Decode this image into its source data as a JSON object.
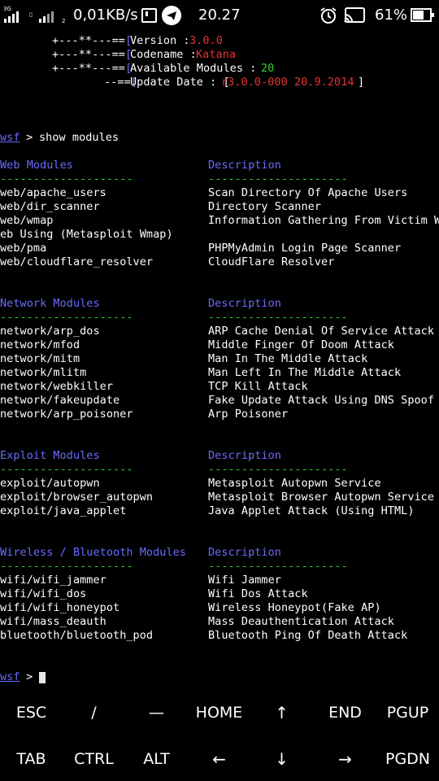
{
  "status_bar": {
    "network_type": "3G",
    "sim_slot": "2",
    "net_speed": "0,01KB/s",
    "time": "20.27",
    "battery": "61%",
    "icons": [
      "signal-icon",
      "signal-icon",
      "sim-icon",
      "telegram-icon",
      "alarm-icon",
      "cast-icon",
      "battery-icon"
    ]
  },
  "banner": [
    {
      "prefix": "+---**---==[",
      "label": "Version :",
      "value": "3.0.0"
    },
    {
      "prefix": "+---**---==[",
      "label": "Codename :",
      "value": "Katana"
    },
    {
      "prefix": "+---**---==[",
      "label": "Available Modules : ",
      "value": "20"
    },
    {
      "prefix": "--==[",
      "label": "Update Date : [",
      "value": "r3.0.0-000 20.9.2014",
      "suffix": "]"
    }
  ],
  "prompt1": {
    "name": "wsf",
    "sep": " > ",
    "command": "show modules"
  },
  "sections": [
    {
      "title": "Web Modules",
      "desc_title": "Description",
      "dash_left": "--------------------",
      "dash_right": "---------------------",
      "rows": [
        {
          "name": "web/apache_users",
          "desc": "Scan Directory Of Apache Users"
        },
        {
          "name": "web/dir_scanner",
          "desc": "Directory Scanner"
        },
        {
          "name": "web/wmap",
          "desc": "Information Gathering From Victim W"
        },
        {
          "name": "eb Using (Metasploit Wmap)",
          "desc": ""
        },
        {
          "name": "web/pma",
          "desc": "PHPMyAdmin Login Page Scanner"
        },
        {
          "name": "web/cloudflare_resolver",
          "desc": "CloudFlare Resolver"
        }
      ]
    },
    {
      "title": "Network Modules",
      "desc_title": "Description",
      "dash_left": "--------------------",
      "dash_right": "---------------------",
      "rows": [
        {
          "name": "network/arp_dos",
          "desc": "ARP Cache Denial Of Service Attack"
        },
        {
          "name": "network/mfod",
          "desc": "Middle Finger Of Doom Attack"
        },
        {
          "name": "network/mitm",
          "desc": "Man In The Middle Attack"
        },
        {
          "name": "network/mlitm",
          "desc": "Man Left In The Middle Attack"
        },
        {
          "name": "network/webkiller",
          "desc": "TCP Kill Attack"
        },
        {
          "name": "network/fakeupdate",
          "desc": "Fake Update Attack Using DNS Spoof"
        },
        {
          "name": "network/arp_poisoner",
          "desc": "Arp Poisoner"
        }
      ]
    },
    {
      "title": "Exploit Modules",
      "desc_title": "Description",
      "dash_left": "--------------------",
      "dash_right": "---------------------",
      "rows": [
        {
          "name": "exploit/autopwn",
          "desc": "Metasploit Autopwn Service"
        },
        {
          "name": "exploit/browser_autopwn",
          "desc": "Metasploit Browser Autopwn Service"
        },
        {
          "name": "exploit/java_applet",
          "desc": "Java Applet Attack (Using HTML)"
        }
      ]
    },
    {
      "title": "Wireless / Bluetooth Modules",
      "desc_title": "Description",
      "dash_left": "--------------------",
      "dash_right": "---------------------",
      "rows": [
        {
          "name": "wifi/wifi_jammer",
          "desc": "Wifi Jammer"
        },
        {
          "name": "wifi/wifi_dos",
          "desc": "Wifi Dos Attack"
        },
        {
          "name": "wifi/wifi_honeypot",
          "desc": "Wireless Honeypot(Fake AP)"
        },
        {
          "name": "wifi/mass_deauth",
          "desc": "Mass Deauthentication Attack"
        },
        {
          "name": "bluetooth/bluetooth_pod",
          "desc": "Bluetooth Ping Of Death Attack"
        }
      ]
    }
  ],
  "prompt2": {
    "name": "wsf",
    "sep": " > "
  },
  "extra_keys": {
    "row1": [
      "ESC",
      "/",
      "—",
      "HOME",
      "↑",
      "END",
      "PGUP"
    ],
    "row2": [
      "TAB",
      "CTRL",
      "ALT",
      "←",
      "↓",
      "→",
      "PGDN"
    ]
  },
  "colors": {
    "background": "#000000",
    "text": "#ffffff",
    "heading": "#6b6bff",
    "accent_green": "#2fd12f",
    "accent_red": "#e63232"
  }
}
